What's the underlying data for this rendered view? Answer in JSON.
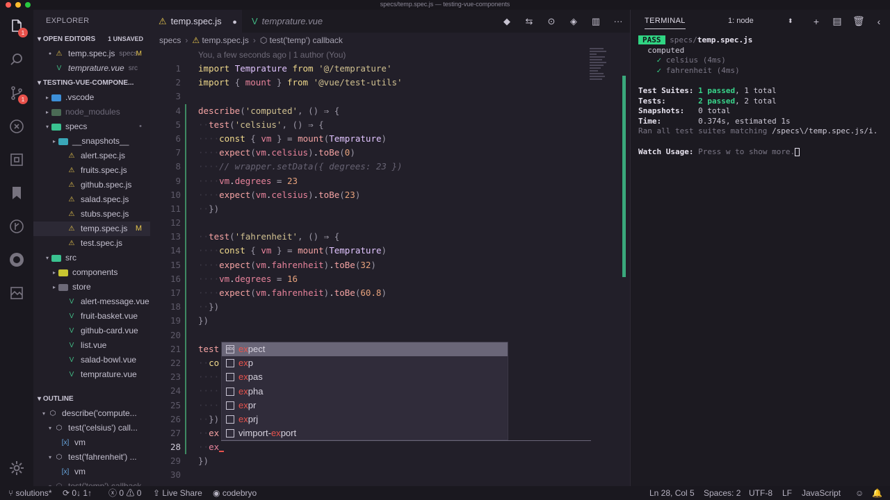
{
  "window": {
    "title": "specs/temp.spec.js — testing-vue-components"
  },
  "colors": {
    "accent": "#30d583",
    "badge": "#e8514b",
    "gutter_modified": "#3e8a62"
  },
  "activity": {
    "explorer_badge": "1",
    "scm_badge": "1"
  },
  "sidebar": {
    "header": "EXPLORER",
    "open_editors": {
      "title": "OPEN EDITORS",
      "meta": "1 UNSAVED"
    },
    "open_files": [
      {
        "name": "temp.spec.js",
        "folder": "specs",
        "flag": "M",
        "type": "js"
      },
      {
        "name": "temprature.vue",
        "folder": "src",
        "flag": "",
        "type": "vue"
      }
    ],
    "project": {
      "title": "TESTING-VUE-COMPONE..."
    },
    "tree": [
      {
        "label": ".vscode",
        "type": "folder",
        "indent": 1,
        "arrow": "▸",
        "flag": ""
      },
      {
        "label": "node_modules",
        "type": "folder-dim",
        "indent": 1,
        "arrow": "▸",
        "flag": ""
      },
      {
        "label": "specs",
        "type": "folder-open",
        "indent": 1,
        "arrow": "▾",
        "flag": "•"
      },
      {
        "label": "__snapshots__",
        "type": "folder",
        "indent": 2,
        "arrow": "▸",
        "flag": ""
      },
      {
        "label": "alert.spec.js",
        "type": "js",
        "indent": 2,
        "arrow": "",
        "flag": ""
      },
      {
        "label": "fruits.spec.js",
        "type": "js",
        "indent": 2,
        "arrow": "",
        "flag": ""
      },
      {
        "label": "github.spec.js",
        "type": "js",
        "indent": 2,
        "arrow": "",
        "flag": ""
      },
      {
        "label": "salad.spec.js",
        "type": "js",
        "indent": 2,
        "arrow": "",
        "flag": ""
      },
      {
        "label": "stubs.spec.js",
        "type": "js",
        "indent": 2,
        "arrow": "",
        "flag": ""
      },
      {
        "label": "temp.spec.js",
        "type": "js",
        "indent": 2,
        "arrow": "",
        "flag": "M"
      },
      {
        "label": "test.spec.js",
        "type": "js",
        "indent": 2,
        "arrow": "",
        "flag": ""
      },
      {
        "label": "src",
        "type": "folder-open",
        "indent": 1,
        "arrow": "▾",
        "flag": ""
      },
      {
        "label": "components",
        "type": "folder",
        "indent": 2,
        "arrow": "▸",
        "flag": ""
      },
      {
        "label": "store",
        "type": "folder",
        "indent": 2,
        "arrow": "▸",
        "flag": ""
      },
      {
        "label": "alert-message.vue",
        "type": "vue",
        "indent": 2,
        "arrow": "",
        "flag": ""
      },
      {
        "label": "fruit-basket.vue",
        "type": "vue",
        "indent": 2,
        "arrow": "",
        "flag": ""
      },
      {
        "label": "github-card.vue",
        "type": "vue",
        "indent": 2,
        "arrow": "",
        "flag": ""
      },
      {
        "label": "list.vue",
        "type": "vue",
        "indent": 2,
        "arrow": "",
        "flag": ""
      },
      {
        "label": "salad-bowl.vue",
        "type": "vue",
        "indent": 2,
        "arrow": "",
        "flag": ""
      },
      {
        "label": "temprature.vue",
        "type": "vue",
        "indent": 2,
        "arrow": "",
        "flag": ""
      }
    ],
    "outline": {
      "title": "OUTLINE",
      "items": [
        {
          "label": "describe('compute...",
          "indent": 1,
          "arrow": "▾",
          "icon": "cube"
        },
        {
          "label": "test('celsius') call...",
          "indent": 2,
          "arrow": "▾",
          "icon": "cube"
        },
        {
          "label": "vm",
          "indent": 3,
          "arrow": "",
          "icon": "var"
        },
        {
          "label": "test('fahrenheit') ...",
          "indent": 2,
          "arrow": "▾",
          "icon": "cube"
        },
        {
          "label": "vm",
          "indent": 3,
          "arrow": "",
          "icon": "var"
        },
        {
          "label": "test('temp') callback",
          "indent": 2,
          "arrow": "▾",
          "icon": "cube"
        }
      ]
    }
  },
  "editor": {
    "tabs": [
      {
        "label": "temp.spec.js",
        "state": "active",
        "dirty": "●"
      },
      {
        "label": "temprature.vue",
        "state": "inactive"
      }
    ],
    "breadcrumb": [
      "specs",
      "temp.spec.js",
      "test('temp') callback"
    ],
    "codelens": "You, a few seconds ago | 1 author (You)",
    "current_line": 28,
    "lines": [
      {
        "n": "1",
        "html": "<span class='kw'>import</span> <span class='cls'>Temprature</span> <span class='kw'>from</span> <span class='str'>'@/temprature'</span>"
      },
      {
        "n": "2",
        "html": "<span class='kw'>import</span> <span class='punc'>{</span> <span class='var'>mount</span> <span class='punc'>}</span> <span class='kw'>from</span> <span class='str'>'@vue/test-utils'</span>"
      },
      {
        "n": "3",
        "html": ""
      },
      {
        "n": "4",
        "html": "<span class='fn'>describe</span><span class='punc'>(</span><span class='str'>'computed'</span><span class='punc'>,</span> <span class='punc'>()</span> <span class='op'>⇒</span> <span class='punc'>{</span>"
      },
      {
        "n": "5",
        "html": "<span class='ws'>··</span><span class='fn'>test</span><span class='punc'>(</span><span class='str'>'celsius'</span><span class='punc'>,</span> <span class='punc'>()</span> <span class='op'>⇒</span> <span class='punc'>{</span>"
      },
      {
        "n": "6",
        "html": "<span class='ws'>····</span><span class='kw'>const</span> <span class='punc'>{</span> <span class='var'>vm</span> <span class='punc'>}</span> <span class='op'>=</span> <span class='fn'>mount</span><span class='punc'>(</span><span class='cls'>Temprature</span><span class='punc'>)</span>"
      },
      {
        "n": "7",
        "html": "<span class='ws'>····</span><span class='fn'>expect</span><span class='punc'>(</span><span class='var'>vm</span>.<span class='var'>celsius</span><span class='punc'>)</span>.<span class='fn'>toBe</span><span class='punc'>(</span><span class='num2'>0</span><span class='punc'>)</span>"
      },
      {
        "n": "8",
        "html": "<span class='ws'>····</span><span class='cmt'>// wrapper.setData({ degrees: 23 })</span>"
      },
      {
        "n": "9",
        "html": "<span class='ws'>····</span><span class='var'>vm</span>.<span class='var'>degrees</span> <span class='op'>=</span> <span class='num2'>23</span>"
      },
      {
        "n": "10",
        "html": "<span class='ws'>····</span><span class='fn'>expect</span><span class='punc'>(</span><span class='var'>vm</span>.<span class='var'>celsius</span><span class='punc'>)</span>.<span class='fn'>toBe</span><span class='punc'>(</span><span class='num2'>23</span><span class='punc'>)</span>"
      },
      {
        "n": "11",
        "html": "<span class='ws'>··</span><span class='punc'>})</span>"
      },
      {
        "n": "12",
        "html": ""
      },
      {
        "n": "13",
        "html": "<span class='ws'>··</span><span class='fn'>test</span><span class='punc'>(</span><span class='str'>'fahrenheit'</span><span class='punc'>,</span> <span class='punc'>()</span> <span class='op'>⇒</span> <span class='punc'>{</span>"
      },
      {
        "n": "14",
        "html": "<span class='ws'>····</span><span class='kw'>const</span> <span class='punc'>{</span> <span class='var'>vm</span> <span class='punc'>}</span> <span class='op'>=</span> <span class='fn'>mount</span><span class='punc'>(</span><span class='cls'>Temprature</span><span class='punc'>)</span>"
      },
      {
        "n": "15",
        "html": "<span class='ws'>····</span><span class='fn'>expect</span><span class='punc'>(</span><span class='var'>vm</span>.<span class='var'>fahrenheit</span><span class='punc'>)</span>.<span class='fn'>toBe</span><span class='punc'>(</span><span class='num2'>32</span><span class='punc'>)</span>"
      },
      {
        "n": "16",
        "html": "<span class='ws'>····</span><span class='var'>vm</span>.<span class='var'>degrees</span> <span class='op'>=</span> <span class='num2'>16</span>"
      },
      {
        "n": "17",
        "html": "<span class='ws'>····</span><span class='fn'>expect</span><span class='punc'>(</span><span class='var'>vm</span>.<span class='var'>fahrenheit</span><span class='punc'>)</span>.<span class='fn'>toBe</span><span class='punc'>(</span><span class='num2'>60.8</span><span class='punc'>)</span>"
      },
      {
        "n": "18",
        "html": "<span class='ws'>··</span><span class='punc'>})</span>"
      },
      {
        "n": "19",
        "html": "<span class='punc'>})</span>"
      },
      {
        "n": "20",
        "html": ""
      },
      {
        "n": "21",
        "html": "<span class='fn'>test</span>"
      },
      {
        "n": "22",
        "html": "<span class='ws'>··</span><span class='kw'>co</span>"
      },
      {
        "n": "23",
        "html": "<span class='ws'>····</span>"
      },
      {
        "n": "24",
        "html": "<span class='ws'>····</span>"
      },
      {
        "n": "25",
        "html": "<span class='ws'>····</span>"
      },
      {
        "n": "26",
        "html": "<span class='ws'>··</span><span class='punc'>})</span>"
      },
      {
        "n": "27",
        "html": "<span class='ws'>··</span><span class='fn'>ex</span>"
      },
      {
        "n": "28",
        "html": "<span class='ws'>··</span><span class='var'>ex</span>"
      },
      {
        "n": "29",
        "html": "<span class='punc'>})</span>"
      },
      {
        "n": "30",
        "html": ""
      }
    ],
    "suggestions": [
      {
        "prefix": "ex",
        "rest": "pect",
        "icon": "abc",
        "selected": true
      },
      {
        "prefix": "ex",
        "rest": "p",
        "icon": "snippet",
        "selected": false
      },
      {
        "prefix": "ex",
        "rest": "pas",
        "icon": "snippet",
        "selected": false
      },
      {
        "prefix": "ex",
        "rest": "pha",
        "icon": "snippet",
        "selected": false
      },
      {
        "prefix": "ex",
        "rest": "pr",
        "icon": "snippet",
        "selected": false
      },
      {
        "prefix": "ex",
        "rest": "prj",
        "icon": "snippet",
        "selected": false
      },
      {
        "before": "vimport-",
        "prefix": "ex",
        "rest": "port",
        "icon": "snippet",
        "selected": false
      }
    ]
  },
  "terminal": {
    "tab": "TERMINAL",
    "selector": "1: node",
    "pass_label": "PASS",
    "file_dir": "specs/",
    "file_name": "temp.spec.js",
    "group": "computed",
    "tests": [
      {
        "name": "celsius",
        "time": "(4ms)"
      },
      {
        "name": "fahrenheit",
        "time": "(4ms)"
      }
    ],
    "summary": [
      {
        "label": "Test Suites:",
        "passed": "1 passed",
        "total": ", 1 total"
      },
      {
        "label": "Tests:",
        "passed": "2 passed",
        "total": ", 2 total"
      },
      {
        "label": "Snapshots:",
        "passed": "",
        "total": "0 total"
      },
      {
        "label": "Time:",
        "passed": "",
        "total": "0.374s, estimated 1s"
      }
    ],
    "ran": "Ran all test suites matching ",
    "ran_pattern": "/specs\\/temp.spec.js/i.",
    "watch_label": "Watch Usage:",
    "watch_text": " Press w to show more."
  },
  "status": {
    "branch": "solutions*",
    "sync": "0↓ 1↑",
    "problems": "0",
    "warnings": "0",
    "live_share": "Live Share",
    "github_user": "codebryo",
    "position": "Ln 28, Col 5",
    "spaces": "Spaces: 2",
    "encoding": "UTF-8",
    "eol": "LF",
    "language": "JavaScript"
  }
}
